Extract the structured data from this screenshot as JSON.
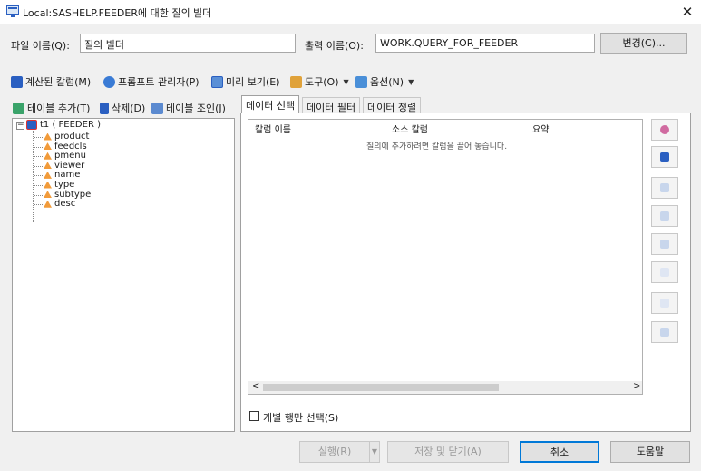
{
  "window": {
    "title": "Local:SASHELP.FEEDER에 대한 질의 빌더",
    "close_label": "✕"
  },
  "header": {
    "file_label": "파일 이름(Q):",
    "file_value": "질의 빌더",
    "output_label": "출력 이름(O):",
    "output_value": "WORK.QUERY_FOR_FEEDER",
    "change_button": "변경(C)..."
  },
  "toolbar": {
    "computed_column": "계산된 칼럼(M)",
    "prompt_manager": "프롬프트 관리자(P)",
    "preview": "미리 보기(E)",
    "tools": "도구(O)",
    "options": "옵션(N)"
  },
  "left_panel": {
    "add_table": "테이블 추가(T)",
    "delete": "삭제(D)",
    "join_tables": "테이블 조인(J)",
    "tree_root": "t1 ( FEEDER )",
    "columns": [
      "product",
      "feedcls",
      "pmenu",
      "viewer",
      "name",
      "type",
      "subtype",
      "desc"
    ]
  },
  "tabs": [
    "데이터 선택",
    "데이터 필터",
    "데이터 정렬"
  ],
  "grid": {
    "headers": [
      "칼럼 이름",
      "소스 칼럼",
      "요약"
    ],
    "empty_message": "질의에 추가하려면 칼럼을 끌어 놓습니다.",
    "scroll_left": "<",
    "scroll_right": ">"
  },
  "distinct_rows_label": "개별 행만 선택(S)",
  "footer": {
    "run": "실행(R)",
    "save_close": "저장 및 닫기(A)",
    "cancel": "취소",
    "help": "도움말"
  },
  "colors": {
    "accent_blue": "#2a5fc1",
    "column_icon": "#f29b3a",
    "primary_border": "#0078d7"
  }
}
